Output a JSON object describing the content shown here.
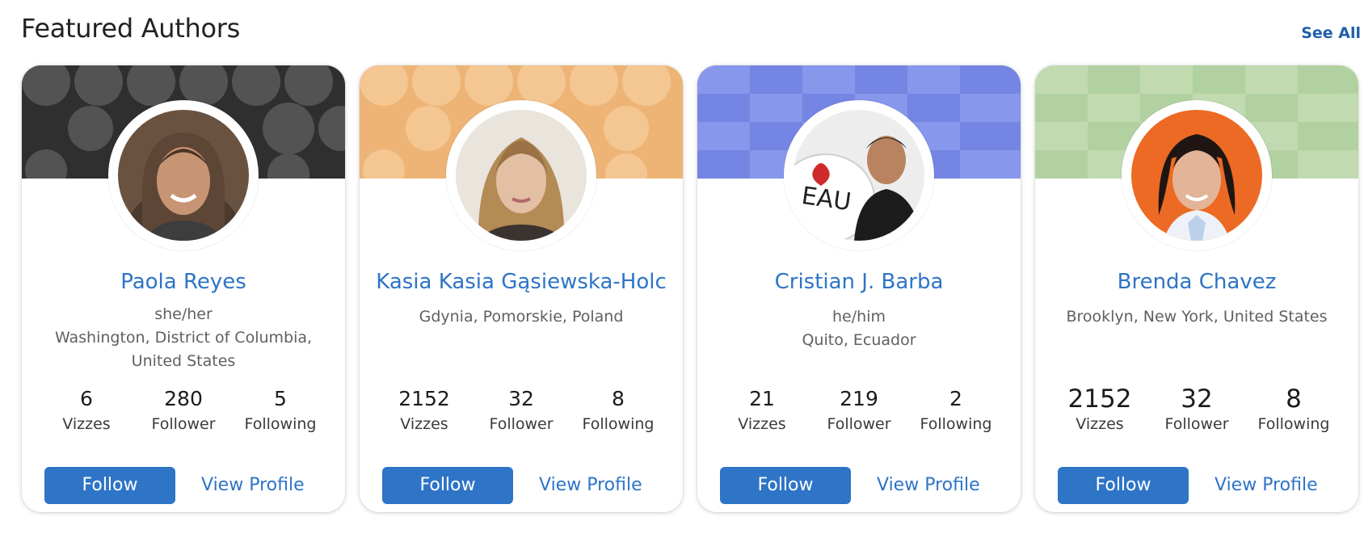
{
  "section": {
    "title": "Featured Authors",
    "see_all_label": "See All"
  },
  "authors": [
    {
      "name": "Paola Reyes",
      "pronouns": "she/her",
      "location": "Washington, District of Columbia, United States",
      "stats": [
        {
          "value": "6",
          "label": "Vizzes"
        },
        {
          "value": "280",
          "label": "Follower"
        },
        {
          "value": "5",
          "label": "Following"
        }
      ],
      "follow_label": "Follow",
      "profile_label": "View Profile",
      "banner_color": "#2f2f2f"
    },
    {
      "name": "Kasia Kasia Gąsiewska-Holc",
      "pronouns": "",
      "location": "Gdynia, Pomorskie, Poland",
      "stats": [
        {
          "value": "2152",
          "label": "Vizzes"
        },
        {
          "value": "32",
          "label": "Follower"
        },
        {
          "value": "8",
          "label": "Following"
        }
      ],
      "follow_label": "Follow",
      "profile_label": "View Profile",
      "banner_color": "#edb475"
    },
    {
      "name": "Cristian J. Barba",
      "pronouns": "he/him",
      "location": "Quito, Ecuador",
      "stats": [
        {
          "value": "21",
          "label": "Vizzes"
        },
        {
          "value": "219",
          "label": "Follower"
        },
        {
          "value": "2",
          "label": "Following"
        }
      ],
      "follow_label": "Follow",
      "profile_label": "View Profile",
      "banner_color": "#7585e3"
    },
    {
      "name": "Brenda Chavez",
      "pronouns": "",
      "location": "Brooklyn, New York, United States",
      "stats": [
        {
          "value": "2152",
          "label": "Vizzes"
        },
        {
          "value": "32",
          "label": "Follower"
        },
        {
          "value": "8",
          "label": "Following"
        }
      ],
      "follow_label": "Follow",
      "profile_label": "View Profile",
      "banner_color": "#b2d1a0"
    }
  ],
  "colors": {
    "accent": "#2e74c7",
    "link": "#1f5fa8"
  }
}
